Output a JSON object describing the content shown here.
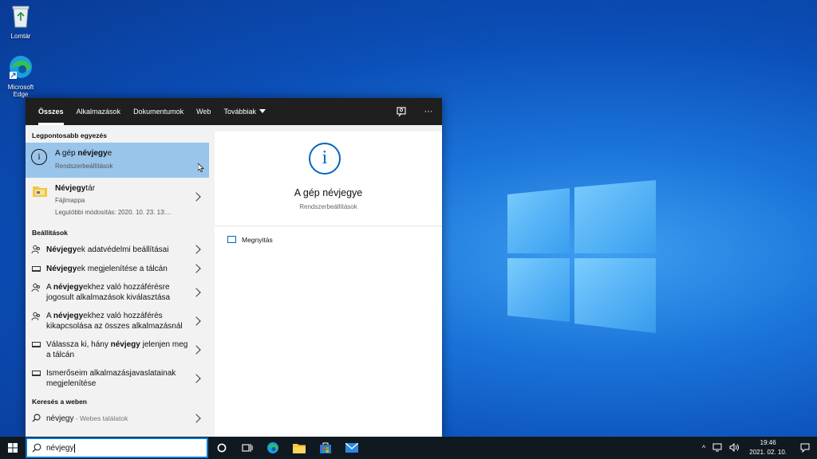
{
  "desktop": {
    "icons": [
      {
        "label": "Lomtár",
        "icon": "recycle-bin-icon"
      },
      {
        "label": "Microsoft Edge",
        "icon": "edge-icon"
      }
    ]
  },
  "tabs": {
    "items": [
      "Összes",
      "Alkalmazások",
      "Dokumentumok",
      "Web",
      "Továbbiak"
    ],
    "active": "Összes"
  },
  "results": {
    "best_match_header": "Legpontosabb egyezés",
    "best_match": {
      "title_pre": "A gép ",
      "title_bold": "névjegy",
      "title_post": "e",
      "subtitle": "Rendszerbeállítások"
    },
    "file": {
      "title_bold": "Névjegy",
      "title_post": "tár",
      "type": "Fájlmappa",
      "modified": "Legutóbbi módosítás: 2020. 10. 23. 13:..."
    },
    "settings_header": "Beállítások",
    "settings": [
      {
        "pre": "",
        "bold": "Névjegy",
        "post": "ek adatvédelmi beállításai",
        "icon": "people-icon"
      },
      {
        "pre": "",
        "bold": "Névjegy",
        "post": "ek megjelenítése a tálcán",
        "icon": "taskbar-icon"
      },
      {
        "pre": "A ",
        "bold": "névjegy",
        "post": "ekhez való hozzáférésre jogosult alkalmazások kiválasztása",
        "icon": "people-icon"
      },
      {
        "pre": "A ",
        "bold": "névjegy",
        "post": "ekhez való hozzáférés kikapcsolása az összes alkalmazásnál",
        "icon": "people-icon"
      },
      {
        "pre": "Válassza ki, hány ",
        "bold": "névjegy",
        "post": " jelenjen meg a tálcán",
        "icon": "taskbar-icon"
      },
      {
        "pre": "Ismerőseim alkalmazásjavaslatainak megjelenítése",
        "bold": "",
        "post": "",
        "icon": "taskbar-icon"
      }
    ],
    "web_header": "Keresés a weben",
    "web": {
      "query": "névjegy",
      "suffix": " - Webes találatok"
    }
  },
  "detail": {
    "title": "A gép névjegye",
    "subtitle": "Rendszerbeállítások",
    "action": "Megnyitás"
  },
  "taskbar": {
    "search_value": "névjegy",
    "time": "19:46",
    "date": "2021. 02. 10."
  },
  "colors": {
    "accent": "#0078d7",
    "selection": "#99c5ea",
    "taskbar": "#101820"
  }
}
